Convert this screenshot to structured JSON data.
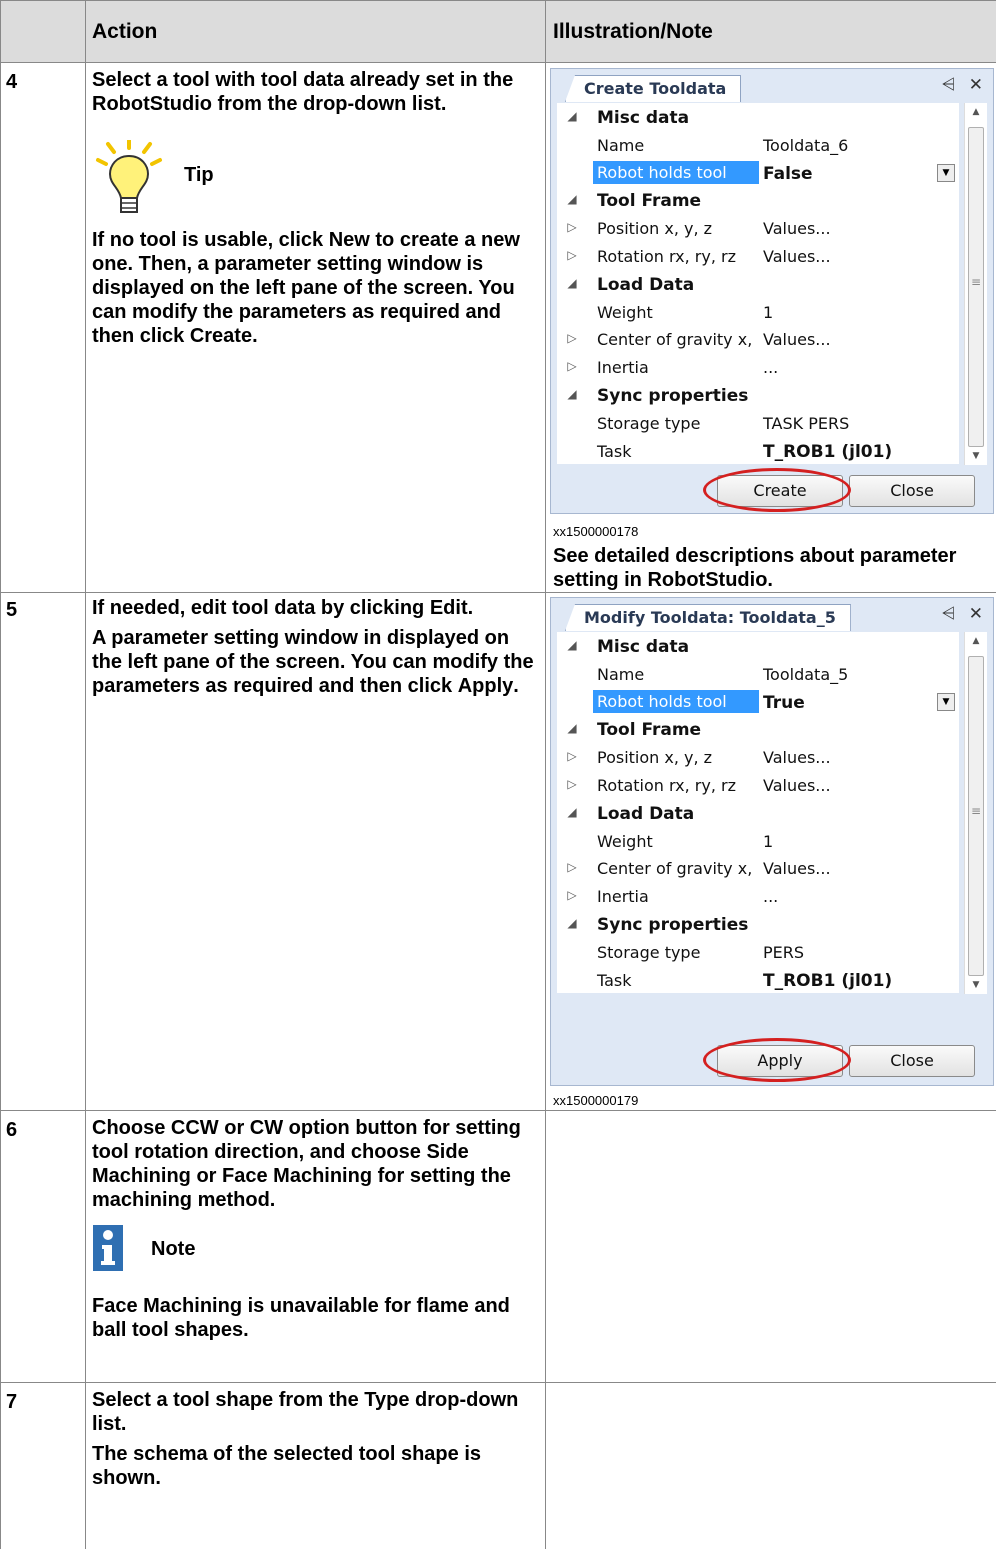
{
  "header": {
    "col_action": "Action",
    "col_note": "Illustration/Note"
  },
  "rows": [
    {
      "step": "4",
      "action": "Select a tool with tool data already set in the RobotStudio from the drop-down list.",
      "tip_label": "Tip",
      "tip_text": [
        "If no tool is usable, click ",
        "New",
        " to create a new one. Then, a parameter setting window is displayed on the left pane of the screen. You can modify the parameters as required and then click ",
        "Create",
        "."
      ],
      "panel": {
        "tab": "Create Tooldata",
        "rows": [
          {
            "type": "cat",
            "k": "Misc data"
          },
          {
            "type": "prop",
            "k": "Name",
            "v": "Tooldata_6"
          },
          {
            "type": "sel",
            "k": "Robot holds tool",
            "v": "False"
          },
          {
            "type": "cat",
            "k": "Tool Frame"
          },
          {
            "type": "exp",
            "k": "Position x, y, z",
            "v": "Values..."
          },
          {
            "type": "exp",
            "k": "Rotation rx, ry, rz",
            "v": "Values..."
          },
          {
            "type": "cat",
            "k": "Load Data"
          },
          {
            "type": "prop",
            "k": "Weight",
            "v": "1"
          },
          {
            "type": "exp",
            "k": "Center of gravity x,",
            "v": "Values..."
          },
          {
            "type": "exp",
            "k": "Inertia",
            "v": "..."
          },
          {
            "type": "cat",
            "k": "Sync properties"
          },
          {
            "type": "prop",
            "k": "Storage type",
            "v": "TASK PERS"
          },
          {
            "type": "propb",
            "k": "Task",
            "v": "T_ROB1 (jl01)"
          }
        ],
        "primary_button": "Create",
        "close_button": "Close"
      },
      "caption": "xx1500000178",
      "note": "See detailed descriptions about parameter setting in RobotStudio."
    },
    {
      "step": "5",
      "action_parts": [
        "If needed, edit tool data by clicking ",
        "Edit",
        "."
      ],
      "action2_parts": [
        "A parameter setting window in displayed on the left pane of the screen. You can modify the parameters as required and then click ",
        "Apply",
        "."
      ],
      "panel": {
        "tab": "Modify Tooldata: Tooldata_5",
        "rows": [
          {
            "type": "cat",
            "k": "Misc data"
          },
          {
            "type": "prop",
            "k": "Name",
            "v": "Tooldata_5"
          },
          {
            "type": "sel",
            "k": "Robot holds tool",
            "v": "True"
          },
          {
            "type": "cat",
            "k": "Tool Frame"
          },
          {
            "type": "exp",
            "k": "Position x, y, z",
            "v": "Values..."
          },
          {
            "type": "exp",
            "k": "Rotation rx, ry, rz",
            "v": "Values..."
          },
          {
            "type": "cat",
            "k": "Load Data"
          },
          {
            "type": "prop",
            "k": "Weight",
            "v": "1"
          },
          {
            "type": "exp",
            "k": "Center of gravity x,",
            "v": "Values..."
          },
          {
            "type": "exp",
            "k": "Inertia",
            "v": "..."
          },
          {
            "type": "cat",
            "k": "Sync properties"
          },
          {
            "type": "prop",
            "k": "Storage type",
            "v": "PERS"
          },
          {
            "type": "propb",
            "k": "Task",
            "v": "T_ROB1 (jl01)"
          }
        ],
        "primary_button": "Apply",
        "close_button": "Close"
      },
      "caption": "xx1500000179"
    },
    {
      "step": "6",
      "action_parts": [
        "Choose ",
        "CCW",
        " or ",
        "CW",
        " option button for setting tool rotation direction, and choose ",
        "Side Machining",
        " or ",
        "Face Machining",
        " for setting the machining method."
      ],
      "note_label": "Note",
      "note_parts": [
        "Face Machining",
        " is unavailable for flame and ball tool shapes."
      ]
    },
    {
      "step": "7",
      "action_parts": [
        "Select a tool shape from the ",
        "Type",
        " drop-down list."
      ],
      "action2": "The schema of the selected tool shape is shown."
    }
  ]
}
